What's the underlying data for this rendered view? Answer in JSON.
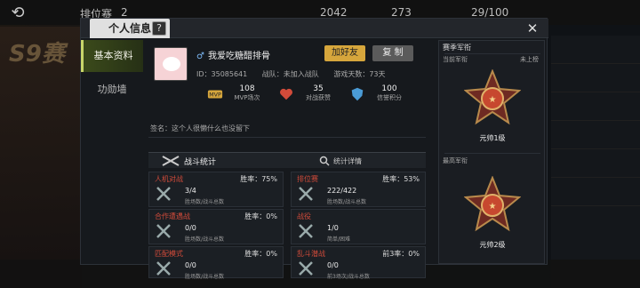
{
  "background": {
    "season_logo": "S9赛"
  },
  "topbar": {
    "back_icon": "back-arrow",
    "mode_text": "排位赛",
    "level_text": "2",
    "gold": "2042",
    "diamond": "273",
    "stamina": "29/100"
  },
  "dialog": {
    "title": "个人信息",
    "help": "?",
    "close": "✕",
    "sidebar": [
      {
        "label": "基本资料",
        "active": true
      },
      {
        "label": "功勋墙",
        "active": false
      }
    ],
    "profile": {
      "gender_icon": "♂",
      "name": "我爱吃糖醋排骨",
      "add_friend": "加好友",
      "copy": "复 制",
      "id_text": "ID：35085641",
      "clan_text": "战队：未加入战队",
      "days_text": "游戏天数：73天",
      "stats": [
        {
          "icon": "mvp-icon",
          "value": "108",
          "label": "MVP场次"
        },
        {
          "icon": "heart-icon",
          "value": "35",
          "label": "对战获赞"
        },
        {
          "icon": "shield-icon",
          "value": "100",
          "label": "信誉积分"
        }
      ],
      "signature": "签名：这个人很懒什么也没留下"
    },
    "battle": {
      "title": "战斗统计",
      "details": "统计详情",
      "cells": [
        {
          "name": "人机对战",
          "rate": "胜率：75%",
          "value": "3/4",
          "sub": "胜场数/战斗总数"
        },
        {
          "name": "排位赛",
          "rate": "胜率：53%",
          "value": "222/422",
          "sub": "胜场数/战斗总数"
        },
        {
          "name": "合作遭遇战",
          "rate": "胜率：0%",
          "value": "0/0",
          "sub": "胜场数/战斗总数"
        },
        {
          "name": "战役",
          "rate": "",
          "value": "1/0",
          "sub": "简单/困难"
        },
        {
          "name": "匹配模式",
          "rate": "胜率：0%",
          "value": "0/0",
          "sub": "胜场数/战斗总数"
        },
        {
          "name": "乱斗潜战",
          "rate": "前3率：0%",
          "value": "0/0",
          "sub": "前3场次/战斗总数"
        }
      ]
    },
    "season": {
      "title": "赛季军衔",
      "current_label": "当前军衔",
      "current_status": "未上榜",
      "current_rank": "元帅1级",
      "best_label": "最高军衔",
      "best_rank": "元帅2级"
    }
  },
  "colors": {
    "accent": "#d6a63c",
    "tab_active": "#c8d66a",
    "mode_name": "#d24b3a"
  }
}
